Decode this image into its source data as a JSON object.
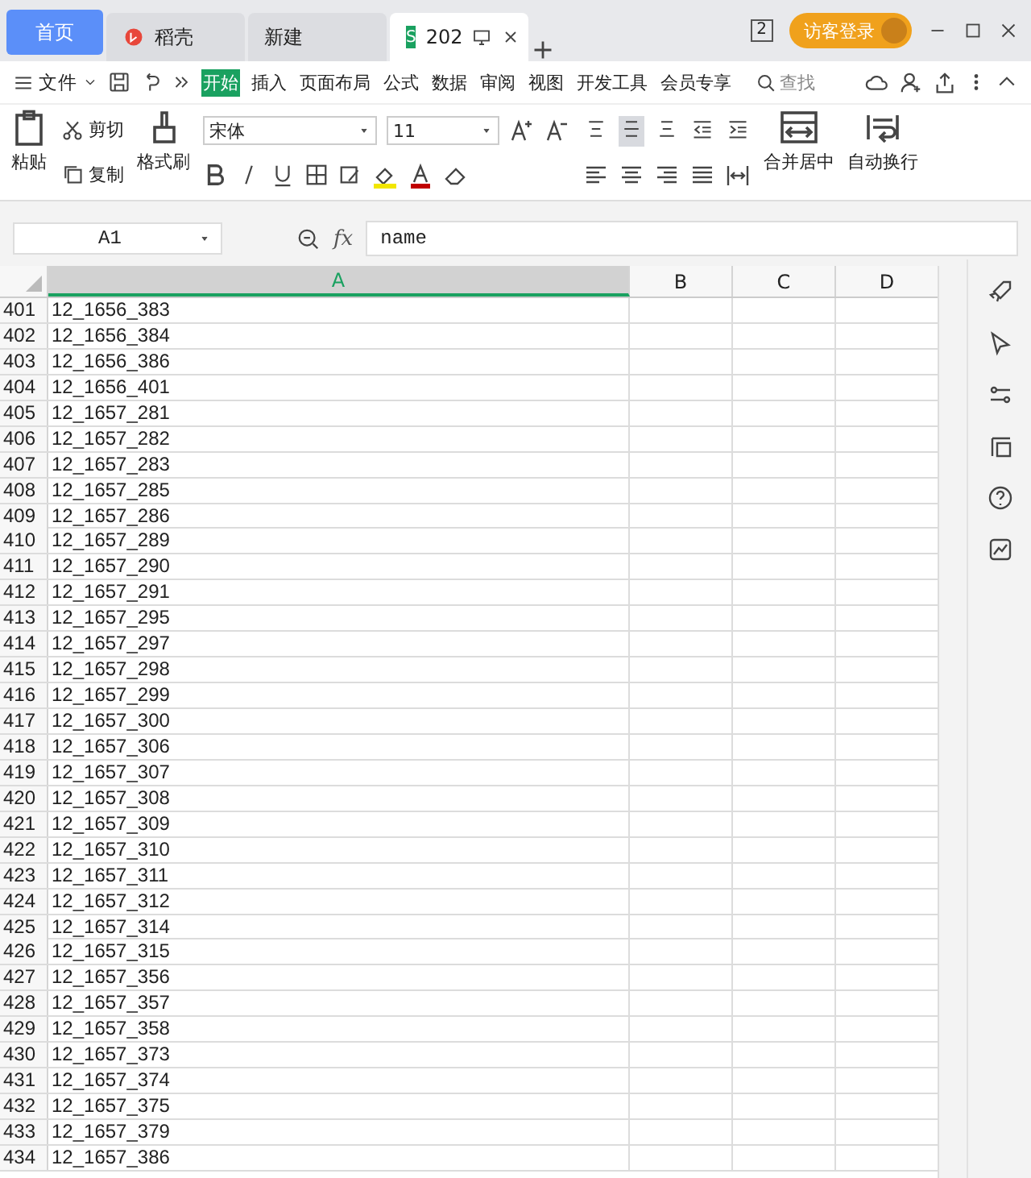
{
  "tabs": [
    {
      "kind": "home",
      "label": "首页",
      "selected": false
    },
    {
      "kind": "docer",
      "label": "稻壳",
      "selected": false
    },
    {
      "kind": "plain",
      "label": "新建",
      "selected": false
    },
    {
      "kind": "sheet",
      "logo": "S",
      "label": "202",
      "selected": true
    }
  ],
  "window_badge": "2",
  "login": "访客登录",
  "file_menu": "文件",
  "ribbon_tabs": [
    {
      "label": "开始",
      "selected": true
    },
    {
      "label": "插入",
      "selected": false
    },
    {
      "label": "页面布局",
      "selected": false
    },
    {
      "label": "公式",
      "selected": false
    },
    {
      "label": "数据",
      "selected": false
    },
    {
      "label": "审阅",
      "selected": false
    },
    {
      "label": "视图",
      "selected": false
    },
    {
      "label": "开发工具",
      "selected": false
    },
    {
      "label": "会员专享",
      "selected": false
    }
  ],
  "search": {
    "placeholder": "查找"
  },
  "clipboard": {
    "paste": "粘贴",
    "cut": "剪切",
    "copy": "复制",
    "format_painter": "格式刷"
  },
  "font": {
    "family": "宋体",
    "size": "11"
  },
  "align_top_row": [
    {
      "kind": "top",
      "selected": false
    },
    {
      "kind": "middle",
      "selected": true
    },
    {
      "kind": "bottom",
      "selected": false
    },
    {
      "kind": "outdent",
      "selected": false
    },
    {
      "kind": "indent",
      "selected": false
    }
  ],
  "merge": "合并居中",
  "wrap": "自动换行",
  "formula_bar": {
    "cell": "A1",
    "fx": "fx",
    "value": "name"
  },
  "columns": [
    {
      "label": "A",
      "selected": true
    },
    {
      "label": "B",
      "selected": false
    },
    {
      "label": "C",
      "selected": false
    },
    {
      "label": "D",
      "selected": false
    }
  ],
  "rows": [
    {
      "num": "401",
      "a": "12_1656_383"
    },
    {
      "num": "402",
      "a": "12_1656_384"
    },
    {
      "num": "403",
      "a": "12_1656_386"
    },
    {
      "num": "404",
      "a": "12_1656_401"
    },
    {
      "num": "405",
      "a": "12_1657_281"
    },
    {
      "num": "406",
      "a": "12_1657_282"
    },
    {
      "num": "407",
      "a": "12_1657_283"
    },
    {
      "num": "408",
      "a": "12_1657_285"
    },
    {
      "num": "409",
      "a": "12_1657_286"
    },
    {
      "num": "410",
      "a": "12_1657_289"
    },
    {
      "num": "411",
      "a": "12_1657_290"
    },
    {
      "num": "412",
      "a": "12_1657_291"
    },
    {
      "num": "413",
      "a": "12_1657_295"
    },
    {
      "num": "414",
      "a": "12_1657_297"
    },
    {
      "num": "415",
      "a": "12_1657_298"
    },
    {
      "num": "416",
      "a": "12_1657_299"
    },
    {
      "num": "417",
      "a": "12_1657_300"
    },
    {
      "num": "418",
      "a": "12_1657_306"
    },
    {
      "num": "419",
      "a": "12_1657_307"
    },
    {
      "num": "420",
      "a": "12_1657_308"
    },
    {
      "num": "421",
      "a": "12_1657_309"
    },
    {
      "num": "422",
      "a": "12_1657_310"
    },
    {
      "num": "423",
      "a": "12_1657_311"
    },
    {
      "num": "424",
      "a": "12_1657_312"
    },
    {
      "num": "425",
      "a": "12_1657_314"
    },
    {
      "num": "426",
      "a": "12_1657_315"
    },
    {
      "num": "427",
      "a": "12_1657_356"
    },
    {
      "num": "428",
      "a": "12_1657_357"
    },
    {
      "num": "429",
      "a": "12_1657_358"
    },
    {
      "num": "430",
      "a": "12_1657_373"
    },
    {
      "num": "431",
      "a": "12_1657_374"
    },
    {
      "num": "432",
      "a": "12_1657_375"
    },
    {
      "num": "433",
      "a": "12_1657_379"
    },
    {
      "num": "434",
      "a": "12_1657_386"
    }
  ]
}
